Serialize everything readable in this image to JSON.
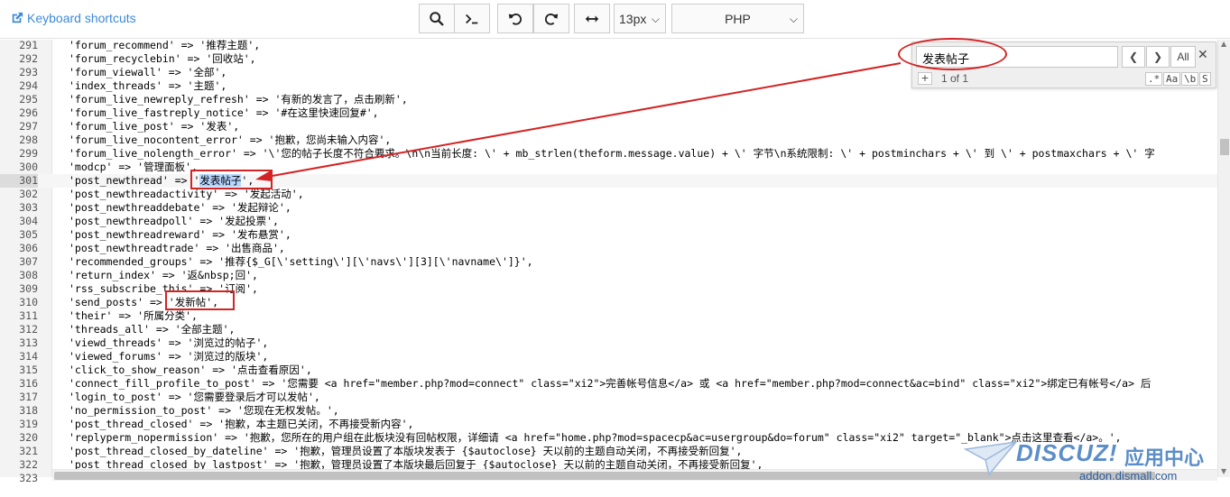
{
  "toolbar": {
    "shortcuts_label": "Keyboard shortcuts",
    "font_size": "13px",
    "language": "PHP"
  },
  "search": {
    "query": "发表帖子",
    "count": "1 of 1",
    "all_label": "All",
    "opt_regex": ".*",
    "opt_case": "Aa",
    "opt_word": "\\b",
    "opt_selection": "S",
    "plus": "+"
  },
  "lines": [
    {
      "n": "291",
      "code": "'forum_recommend' => '推荐主题',"
    },
    {
      "n": "292",
      "code": "'forum_recyclebin' => '回收站',"
    },
    {
      "n": "293",
      "code": "'forum_viewall' => '全部',"
    },
    {
      "n": "294",
      "code": "'index_threads' => '主题',"
    },
    {
      "n": "295",
      "code": "'forum_live_newreply_refresh' => '有新的发言了，点击刷新',"
    },
    {
      "n": "296",
      "code": "'forum_live_fastreply_notice' => '#在这里快速回复#',"
    },
    {
      "n": "297",
      "code": "'forum_live_post' => '发表',"
    },
    {
      "n": "298",
      "code": "'forum_live_nocontent_error' => '抱歉，您尚未输入内容',"
    },
    {
      "n": "299",
      "code": "'forum_live_nolength_error' => '\\'您的帖子长度不符合要求。\\n\\n当前长度: \\' + mb_strlen(theform.message.value) + \\' 字节\\n系统限制: \\' + postminchars + \\' 到 \\' + postmaxchars + \\' 字"
    },
    {
      "n": "300",
      "code": "'modcp' => '管理面板',"
    },
    {
      "n": "301",
      "code": "'post_newthread' => '发表帖子',"
    },
    {
      "n": "302",
      "code": "'post_newthreadactivity' => '发起活动',"
    },
    {
      "n": "303",
      "code": "'post_newthreaddebate' => '发起辩论',"
    },
    {
      "n": "304",
      "code": "'post_newthreadpoll' => '发起投票',"
    },
    {
      "n": "305",
      "code": "'post_newthreadreward' => '发布悬赏',"
    },
    {
      "n": "306",
      "code": "'post_newthreadtrade' => '出售商品',"
    },
    {
      "n": "307",
      "code": "'recommended_groups' => '推荐{$_G[\\'setting\\'][\\'navs\\'][3][\\'navname\\']}',"
    },
    {
      "n": "308",
      "code": "'return_index' => '返&nbsp;回',"
    },
    {
      "n": "309",
      "code": "'rss_subscribe_this' => '订阅',"
    },
    {
      "n": "310",
      "code": "'send_posts' => '发新帖',"
    },
    {
      "n": "311",
      "code": "'their' => '所属分类',"
    },
    {
      "n": "312",
      "code": "'threads_all' => '全部主题',"
    },
    {
      "n": "313",
      "code": "'viewd_threads' => '浏览过的帖子',"
    },
    {
      "n": "314",
      "code": "'viewed_forums' => '浏览过的版块',"
    },
    {
      "n": "315",
      "code": "'click_to_show_reason' => '点击查看原因',"
    },
    {
      "n": "316",
      "code": "'connect_fill_profile_to_post' => '您需要 <a href=\"member.php?mod=connect\" class=\"xi2\">完善帐号信息</a> 或 <a href=\"member.php?mod=connect&ac=bind\" class=\"xi2\">绑定已有帐号</a> 后"
    },
    {
      "n": "317",
      "code": "'login_to_post' => '您需要登录后才可以发帖',"
    },
    {
      "n": "318",
      "code": "'no_permission_to_post' => '您现在无权发帖。',"
    },
    {
      "n": "319",
      "code": "'post_thread_closed' => '抱歉，本主题已关闭，不再接受新内容',"
    },
    {
      "n": "320",
      "code": "'replyperm_nopermission' => '抱歉，您所在的用户组在此板块没有回帖权限，详细请 <a href=\"home.php?mod=spacecp&ac=usergroup&do=forum\" class=\"xi2\" target=\"_blank\">点击这里查看</a>。',"
    },
    {
      "n": "321",
      "code": "'post_thread_closed_by_dateline' => '抱歉，管理员设置了本版块发表于 {$autoclose} 天以前的主题自动关闭，不再接受新回复',"
    },
    {
      "n": "322",
      "code": "'post_thread_closed_by_lastpost' => '抱歉，管理员设置了本版块最后回复于 {$autoclose} 天以前的主题自动关闭，不再接受新回复',"
    },
    {
      "n": "323",
      "code": ""
    }
  ],
  "watermark": {
    "brand": "DISCUZ!",
    "cn": "应用中心",
    "url": "addon.dismall.com"
  },
  "colors": {
    "annotation": "#d42323",
    "link": "#3c8ad8",
    "selection": "#b5d5ff"
  }
}
